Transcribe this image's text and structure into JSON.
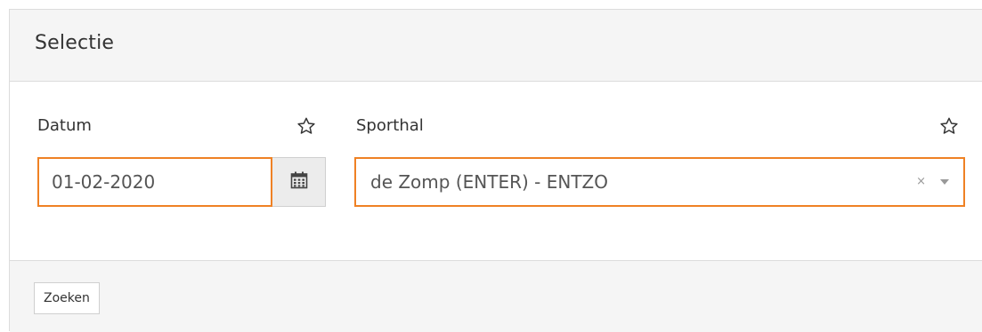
{
  "panel": {
    "title": "Selectie"
  },
  "fields": {
    "date": {
      "label": "Datum",
      "value": "01-02-2020"
    },
    "hall": {
      "label": "Sporthal",
      "value": "de Zomp (ENTER) - ENTZO",
      "clear_symbol": "×"
    }
  },
  "footer": {
    "search_label": "Zoeken"
  },
  "icons": {
    "favorite": "star-outline-icon",
    "calendar": "calendar-icon",
    "dropdown": "caret-down-icon"
  },
  "colors": {
    "accent": "#ef8124",
    "header_bg": "#f5f5f5",
    "border": "#dcdcdc"
  }
}
